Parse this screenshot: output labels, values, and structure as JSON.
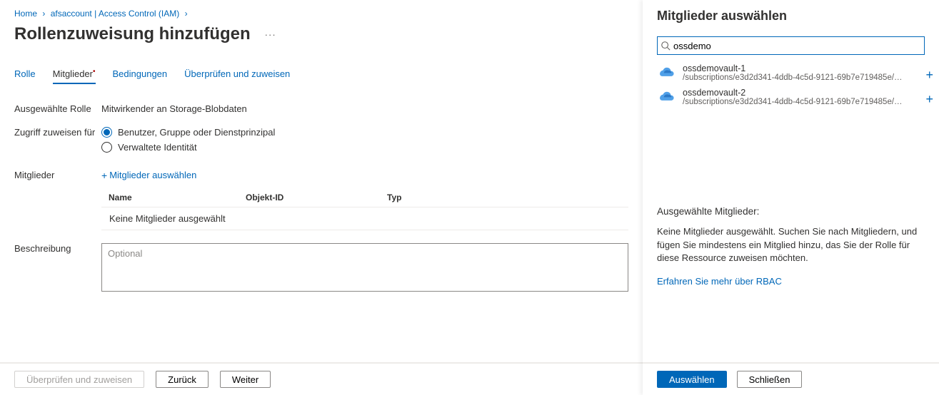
{
  "breadcrumb": {
    "home": "Home",
    "account": "afsaccount | Access Control (IAM)"
  },
  "page_title": "Rollenzuweisung hinzufügen",
  "tabs": {
    "role": "Rolle",
    "members": "Mitglieder",
    "conditions": "Bedingungen",
    "review": "Überprüfen und zuweisen"
  },
  "form": {
    "role_label": "Ausgewählte Rolle",
    "role_value": "Mitwirkender an Storage-Blobdaten",
    "assign_label": "Zugriff zuweisen für",
    "radio_user": "Benutzer, Gruppe oder Dienstprinzipal",
    "radio_mi": "Verwaltete Identität",
    "members_label": "Mitglieder",
    "add_members": "Mitglieder auswählen",
    "table": {
      "name": "Name",
      "obj": "Objekt-ID",
      "typ": "Typ",
      "empty": "Keine Mitglieder ausgewählt"
    },
    "desc_label": "Beschreibung",
    "desc_placeholder": "Optional"
  },
  "footer": {
    "review": "Überprüfen und zuweisen",
    "back": "Zurück",
    "next": "Weiter"
  },
  "panel": {
    "title": "Mitglieder auswählen",
    "search_value": "ossdemo",
    "results": [
      {
        "name": "ossdemovault-1",
        "path": "/subscriptions/e3d2d341-4ddb-4c5d-9121-69b7e719485e/resource…"
      },
      {
        "name": "ossdemovault-2",
        "path": "/subscriptions/e3d2d341-4ddb-4c5d-9121-69b7e719485e/resource…"
      }
    ],
    "selected_title": "Ausgewählte Mitglieder:",
    "selected_empty": "Keine Mitglieder ausgewählt. Suchen Sie nach Mitgliedern, und fügen Sie mindestens ein Mitglied hinzu, das Sie der Rolle für diese Ressource zuweisen möchten.",
    "rbac_link": "Erfahren Sie mehr über RBAC",
    "select_btn": "Auswählen",
    "close_btn": "Schließen"
  }
}
